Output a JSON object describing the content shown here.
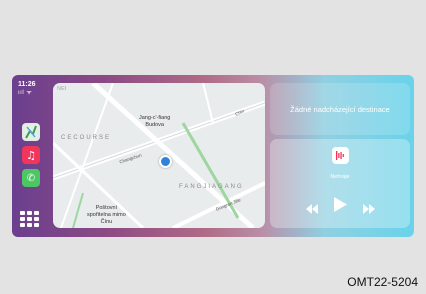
{
  "status": {
    "time": "11:26",
    "signal": "ııl ᯤ"
  },
  "sidebar": {
    "apps": [
      {
        "name": "Maps",
        "icon": "maps-icon"
      },
      {
        "name": "Music",
        "icon": "music-icon"
      },
      {
        "name": "Phone",
        "icon": "phone-icon"
      }
    ],
    "grid_icon": "app-grid-icon"
  },
  "map": {
    "labels": {
      "top_left": "NEI",
      "place": "Jang-c'-fiang\nBudova",
      "district_west": "CECOURSE",
      "road_west": "Changchun",
      "district_east": "FANGJIAGANG",
      "road_east": "Gongren Jilie",
      "road_ne": "Chin",
      "poi": "Poštovní\nspořitelna mimo\nČínu"
    }
  },
  "destination": {
    "text": "Žádné nadcházející destinace"
  },
  "media": {
    "status": "Nehraje",
    "icons": [
      "rewind-icon",
      "play-icon",
      "fast-forward-icon"
    ]
  },
  "caption": "OMT22-5204",
  "colors": {
    "accent": "#2f82d8",
    "music": "#f0365b",
    "phone": "#4cc764",
    "maps": "#3f9b56"
  }
}
